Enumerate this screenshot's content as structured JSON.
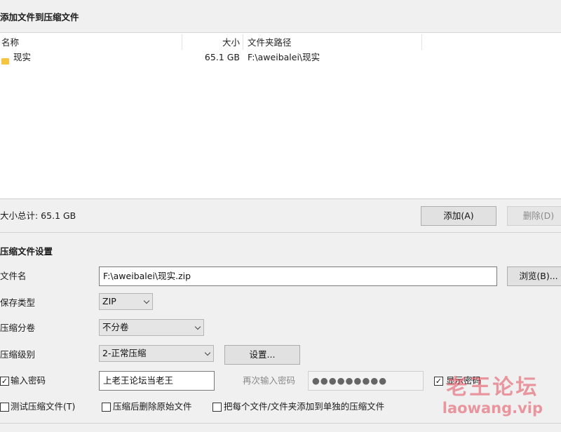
{
  "add_section": {
    "title": "添加文件到压缩文件"
  },
  "file_list": {
    "columns": [
      "名称",
      "大小",
      "文件夹路径"
    ],
    "rows": [
      {
        "name": "现实",
        "size": "65.1 GB",
        "path": "F:\\aweibalei\\现实",
        "icon": "folder-icon"
      }
    ]
  },
  "summary": {
    "total_size": "大小总计: 65.1 GB"
  },
  "buttons": {
    "add": "添加(A)",
    "delete": "删除(D)",
    "browse": "浏览(B)...",
    "settings": "设置..."
  },
  "settings": {
    "title": "压缩文件设置",
    "filename_label": "文件名",
    "filename_value": "F:\\aweibalei\\现实.zip",
    "type_label": "保存类型",
    "type_value": "ZIP",
    "split_label": "压缩分卷",
    "split_value": "不分卷",
    "level_label": "压缩级别",
    "level_value": "2-正常压缩"
  },
  "password": {
    "checkbox_label": "输入密码",
    "checked": true,
    "value": "上老王论坛当老王",
    "reenter_label": "再次输入密码",
    "reenter_value": "●●●●●●●●●",
    "show_label": "显示密码",
    "show_checked": true
  },
  "options": {
    "test": {
      "label": "测试压缩文件(T)",
      "checked": false
    },
    "delete_after": {
      "label": "压缩后删除原始文件",
      "checked": false
    },
    "separate": {
      "label": "把每个文件/文件夹添加到单独的压缩文件",
      "checked": false
    }
  },
  "watermark": {
    "text_cn": "老王论坛",
    "text_en": "laowang.vip"
  },
  "colors": {
    "watermark": "#e24b5a",
    "folder": "#f5c542"
  }
}
